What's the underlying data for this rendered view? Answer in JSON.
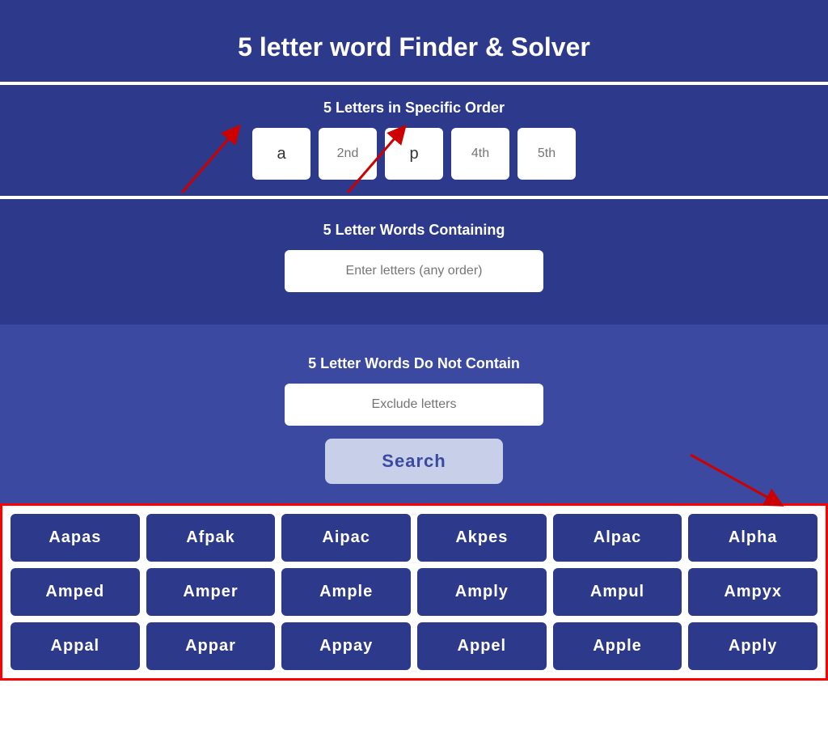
{
  "page": {
    "title": "5 letter word Finder & Solver",
    "specific_order_label": "5 Letters in Specific Order",
    "containing_label": "5 Letter Words Containing",
    "not_contain_label": "5 Letter Words Do Not Contain",
    "containing_placeholder": "Enter letters (any order)",
    "exclude_placeholder": "Exclude letters",
    "search_button_label": "Search",
    "letter_boxes": [
      {
        "value": "a",
        "placeholder": "a"
      },
      {
        "value": "",
        "placeholder": "2nd"
      },
      {
        "value": "p",
        "placeholder": "p"
      },
      {
        "value": "",
        "placeholder": "4th"
      },
      {
        "value": "",
        "placeholder": "5th"
      }
    ],
    "results": [
      "Aapas",
      "Afpak",
      "Aipac",
      "Akpes",
      "Alpac",
      "Alpha",
      "Amped",
      "Amper",
      "Ample",
      "Amply",
      "Ampul",
      "Ampyx",
      "Appal",
      "Appar",
      "Appay",
      "Appel",
      "Apple",
      "Apply"
    ]
  }
}
